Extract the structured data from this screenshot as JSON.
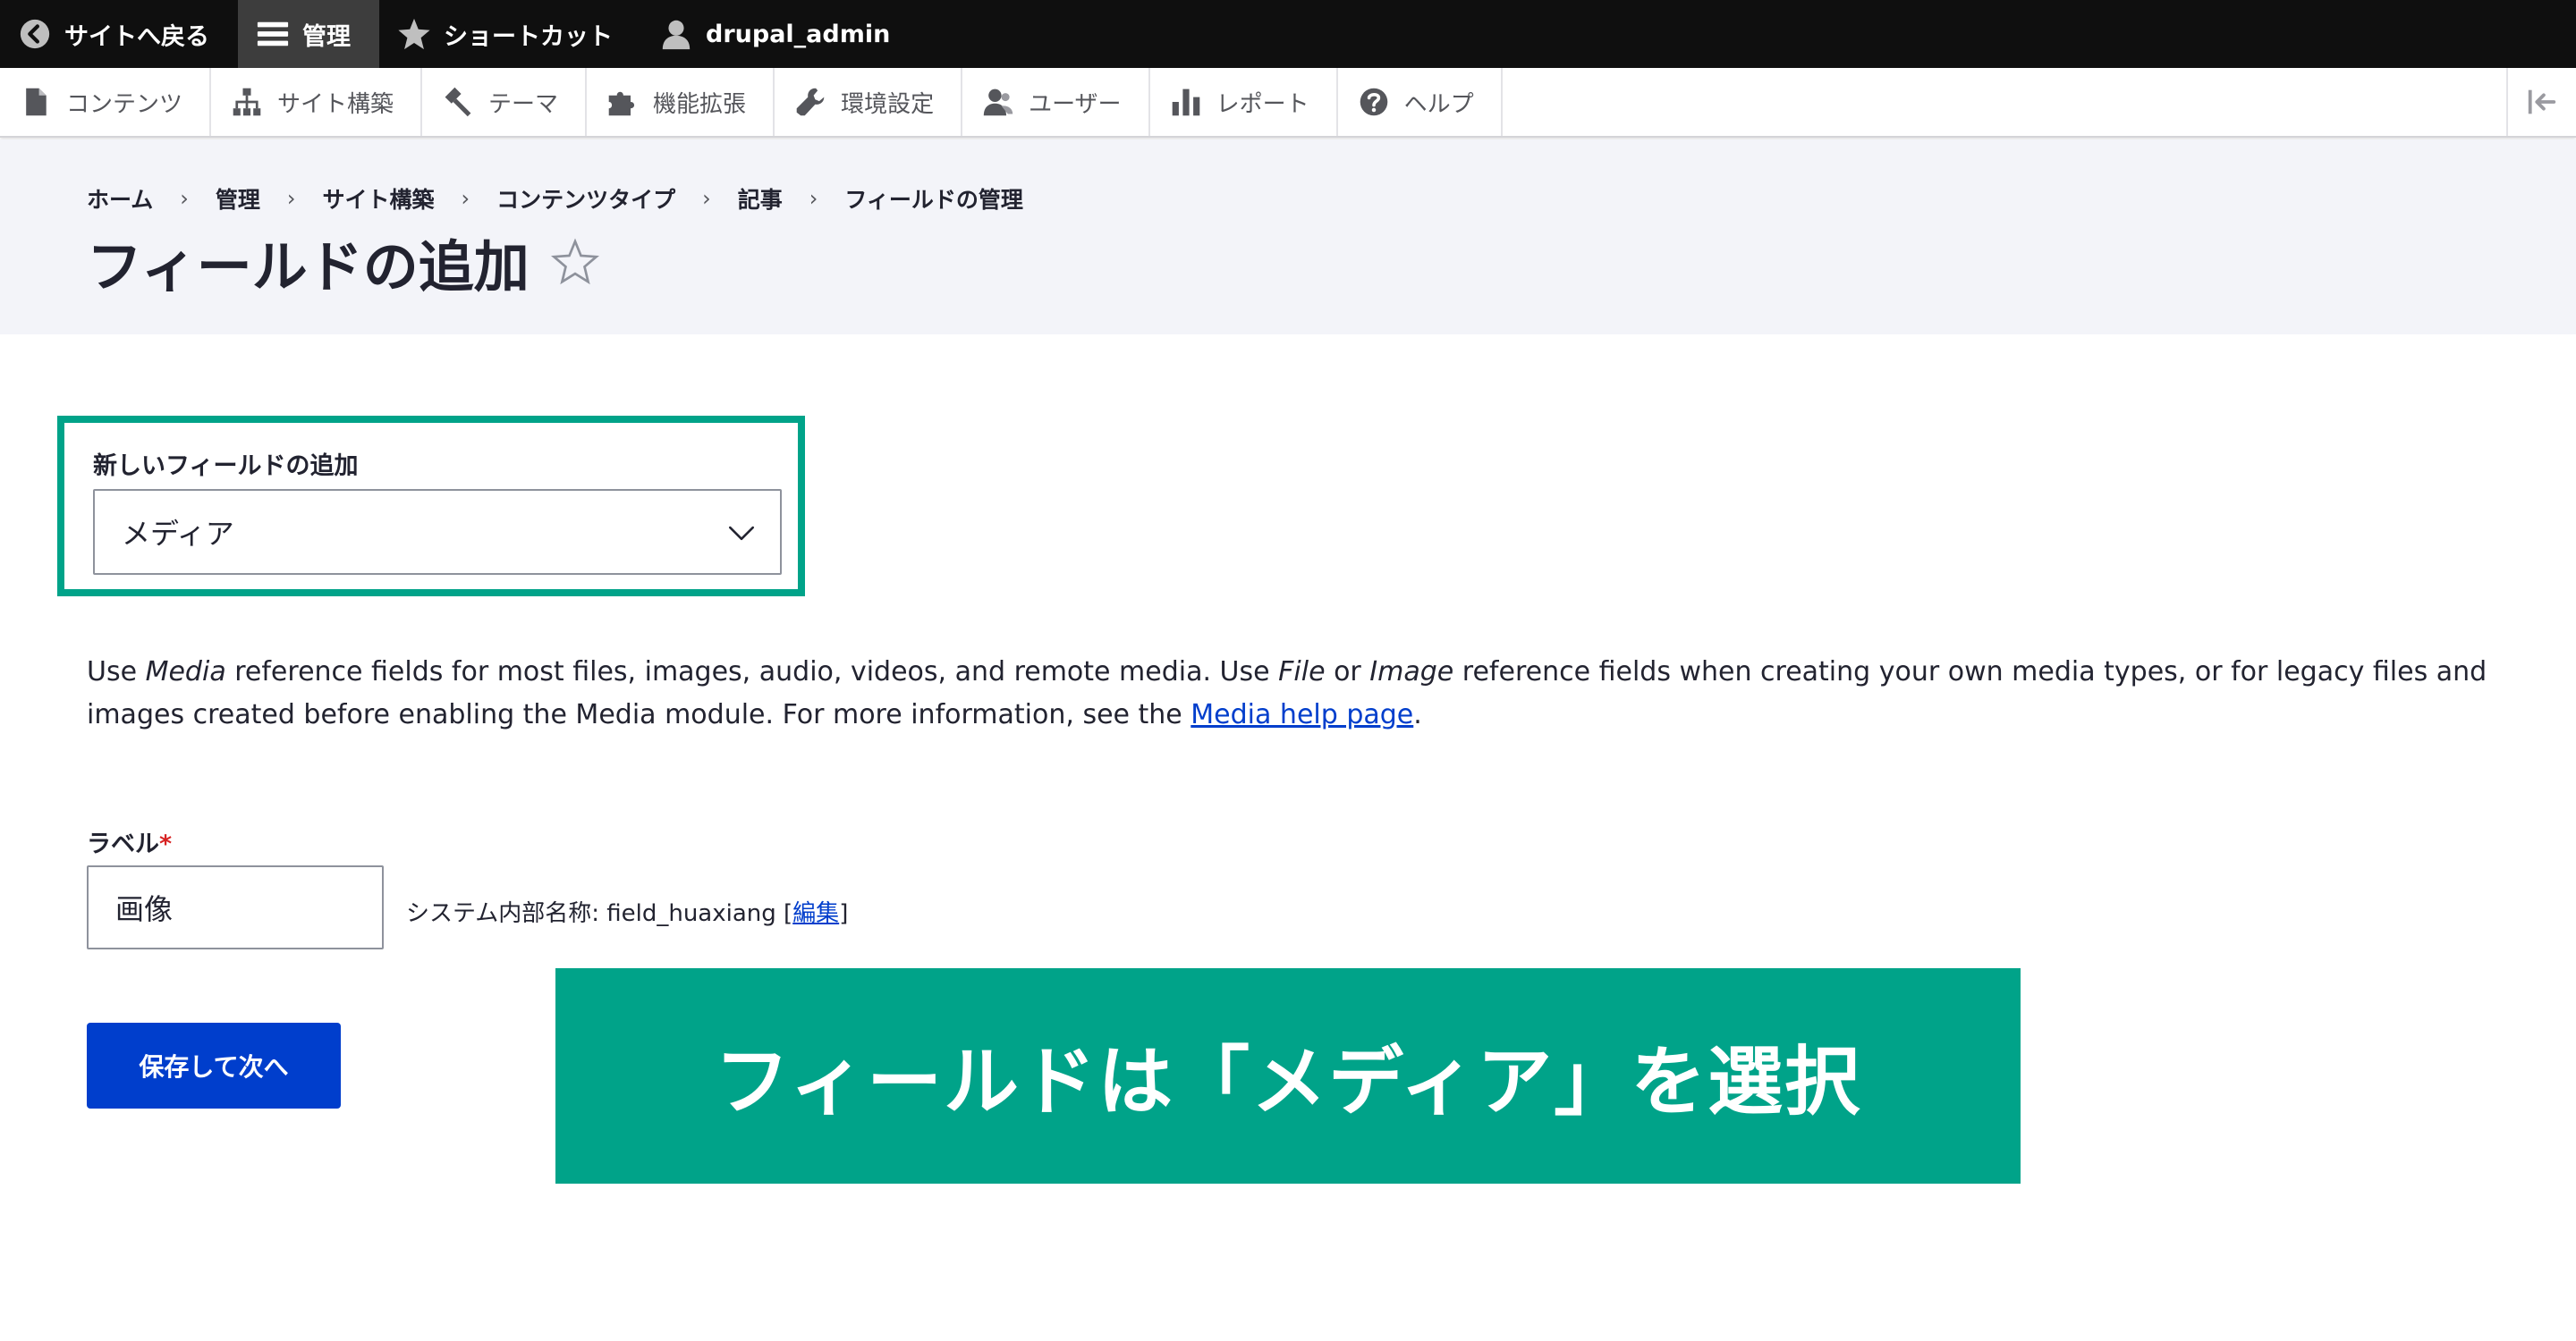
{
  "toolbar": {
    "back_to_site": "サイトへ戻る",
    "manage": "管理",
    "shortcuts": "ショートカット",
    "user": "drupal_admin"
  },
  "tray": {
    "items": [
      {
        "label": "コンテンツ",
        "icon": "file-icon"
      },
      {
        "label": "サイト構築",
        "icon": "sitemap-icon"
      },
      {
        "label": "テーマ",
        "icon": "paintbrush-icon"
      },
      {
        "label": "機能拡張",
        "icon": "puzzle-icon"
      },
      {
        "label": "環境設定",
        "icon": "wrench-icon"
      },
      {
        "label": "ユーザー",
        "icon": "people-icon"
      },
      {
        "label": "レポート",
        "icon": "bar-chart-icon"
      },
      {
        "label": "ヘルプ",
        "icon": "help-icon"
      }
    ],
    "toggle_icon": "collapse-icon"
  },
  "breadcrumb": [
    "ホーム",
    "管理",
    "サイト構築",
    "コンテンツタイプ",
    "記事",
    "フィールドの管理"
  ],
  "page_title": "フィールドの追加",
  "add_field": {
    "label": "新しいフィールドの追加",
    "selected": "メディア"
  },
  "description": {
    "p1": "Use ",
    "em1": "Media",
    "p2": " reference fields for most files, images, audio, videos, and remote media. Use ",
    "em2": "File",
    "p3": " or ",
    "em3": "Image",
    "p4": " reference fields when creating your own media types, or for legacy files and images created before enabling the Media module. For more information, see the ",
    "link": "Media help page",
    "p5": "."
  },
  "label_field": {
    "title": "ラベル",
    "required_mark": "*",
    "value": "画像",
    "machine_prefix": "システム内部名称: field_huaxiang [",
    "machine_edit": "編集",
    "machine_suffix": "]"
  },
  "submit_label": "保存して次へ",
  "callout_text": "フィールドは「メディア」を選択",
  "colors": {
    "toolbar_bg": "#0f0f0f",
    "accent_green": "#00a389",
    "primary_button": "#003ecc",
    "header_bg": "#f3f4f9"
  }
}
